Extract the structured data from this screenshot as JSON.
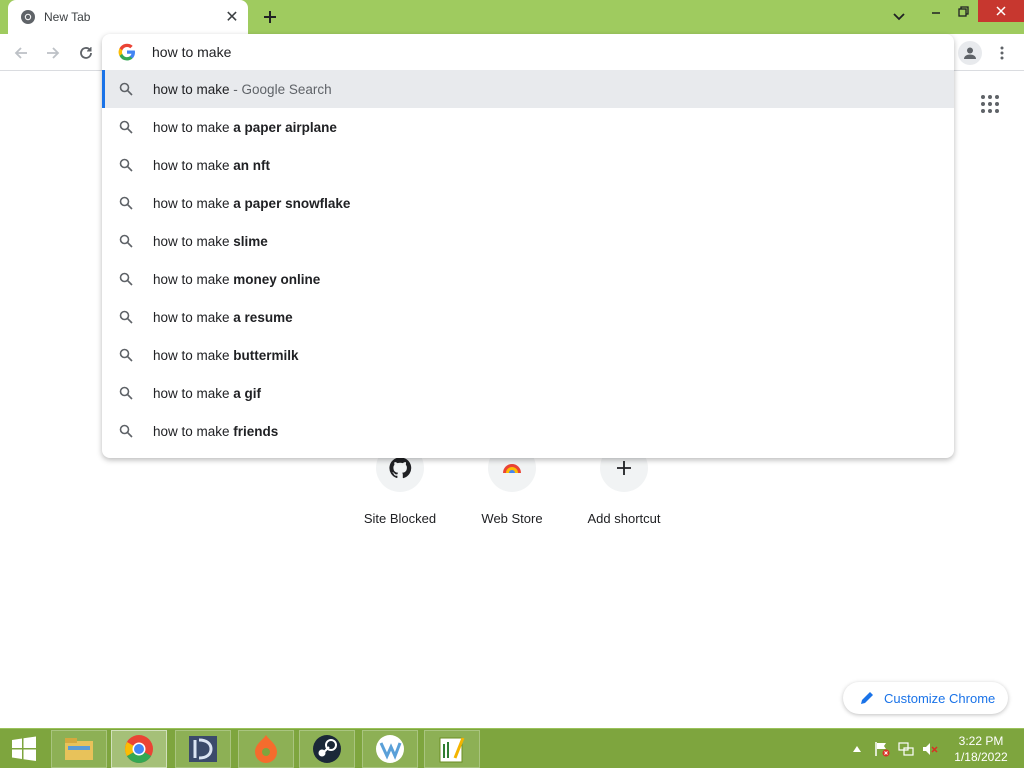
{
  "tab": {
    "title": "New Tab",
    "favicon": "chrome-icon",
    "close_icon": "close-icon"
  },
  "new_tab_icon": "plus-icon",
  "window_controls": {
    "minimize": "minimize-icon",
    "restore": "restore-icon",
    "close": "close-icon"
  },
  "toolbar": {
    "back_icon": "arrow-left-icon",
    "forward_icon": "arrow-right-icon",
    "reload_icon": "reload-icon",
    "profile_icon": "person-icon",
    "menu_icon": "kebab-menu-icon"
  },
  "omnibox": {
    "value": "how to make",
    "suggestions": [
      {
        "prefix": "how to make",
        "bold": "",
        "suffix": " - Google Search",
        "selected": true
      },
      {
        "prefix": "how to make ",
        "bold": "a paper airplane",
        "suffix": "",
        "selected": false
      },
      {
        "prefix": "how to make ",
        "bold": "an nft",
        "suffix": "",
        "selected": false
      },
      {
        "prefix": "how to make ",
        "bold": "a paper snowflake",
        "suffix": "",
        "selected": false
      },
      {
        "prefix": "how to make ",
        "bold": "slime",
        "suffix": "",
        "selected": false
      },
      {
        "prefix": "how to make ",
        "bold": "money online",
        "suffix": "",
        "selected": false
      },
      {
        "prefix": "how to make ",
        "bold": "a resume",
        "suffix": "",
        "selected": false
      },
      {
        "prefix": "how to make ",
        "bold": "buttermilk",
        "suffix": "",
        "selected": false
      },
      {
        "prefix": "how to make ",
        "bold": "a gif",
        "suffix": "",
        "selected": false
      },
      {
        "prefix": "how to make ",
        "bold": "friends",
        "suffix": "",
        "selected": false
      }
    ]
  },
  "shortcuts": [
    {
      "label": "Site Blocked",
      "icon": "github-icon"
    },
    {
      "label": "Web Store",
      "icon": "chrome-web-store-icon"
    },
    {
      "label": "Add shortcut",
      "icon": "plus-icon"
    }
  ],
  "customize": {
    "label": "Customize Chrome",
    "icon": "pencil-icon"
  },
  "taskbar": {
    "apps": [
      "file-explorer-icon",
      "chrome-icon",
      "ide-icon",
      "origin-icon",
      "steam-icon",
      "vk-icon",
      "notepad-plus-icon"
    ],
    "tray_icons": [
      "show-hidden-icons-icon",
      "action-center-flag-icon",
      "network-icon",
      "volume-muted-icon"
    ],
    "time": "3:22 PM",
    "date": "1/18/2022"
  },
  "colors": {
    "titlebar": "#9fcb5f",
    "taskbar": "#7ea53e",
    "accent": "#1a73e8",
    "close_button": "#c7372f"
  }
}
